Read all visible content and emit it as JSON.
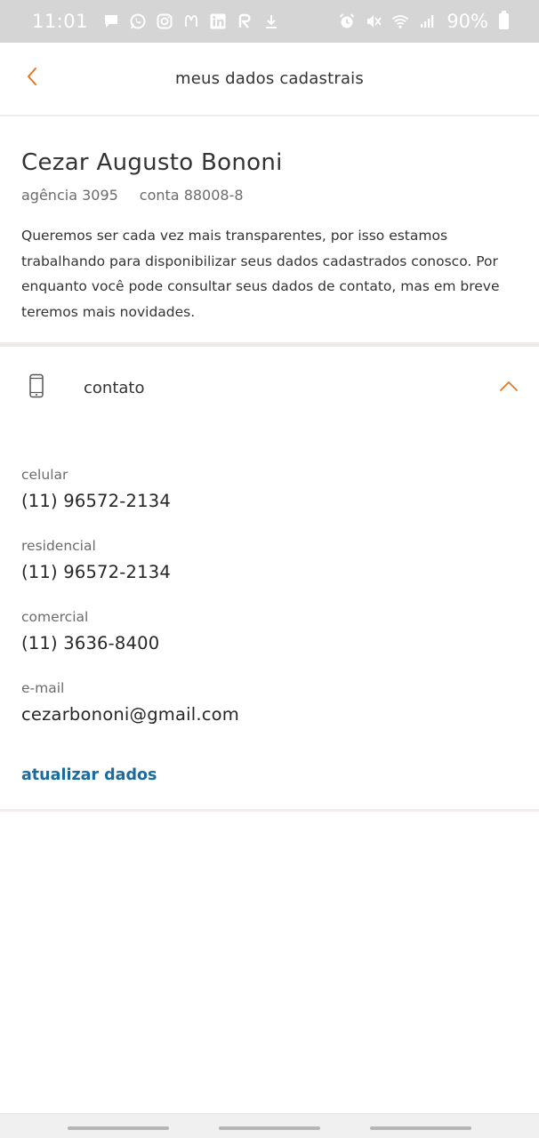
{
  "status_bar": {
    "time": "11:01",
    "battery": "90%",
    "left_icons": [
      "message-icon",
      "whatsapp-icon",
      "instagram-icon",
      "mcdonalds-icon",
      "linkedin-icon",
      "r-app-icon",
      "download-icon"
    ],
    "right_icons": [
      "alarm-icon",
      "mute-icon",
      "wifi-icon",
      "signal-icon",
      "battery-icon"
    ]
  },
  "header": {
    "title": "meus dados cadastrais",
    "accent_color": "#e87722"
  },
  "profile": {
    "name": "Cezar Augusto Bononi",
    "agency": "agência 3095",
    "account": "conta 88008-8",
    "intro": "Queremos ser cada vez mais transparentes, por isso estamos trabalhando para disponibilizar seus dados cadastrados conosco. Por enquanto você pode consultar seus dados de contato, mas em breve teremos mais novidades."
  },
  "contact": {
    "section_label": "contato",
    "fields": [
      {
        "label": "celular",
        "value": "(11) 96572-2134"
      },
      {
        "label": "residencial",
        "value": "(11) 96572-2134"
      },
      {
        "label": "comercial",
        "value": "(11) 3636-8400"
      },
      {
        "label": "e-mail",
        "value": "cezarbononi@gmail.com"
      }
    ],
    "update_label": "atualizar dados",
    "link_color": "#1a6ba0"
  }
}
